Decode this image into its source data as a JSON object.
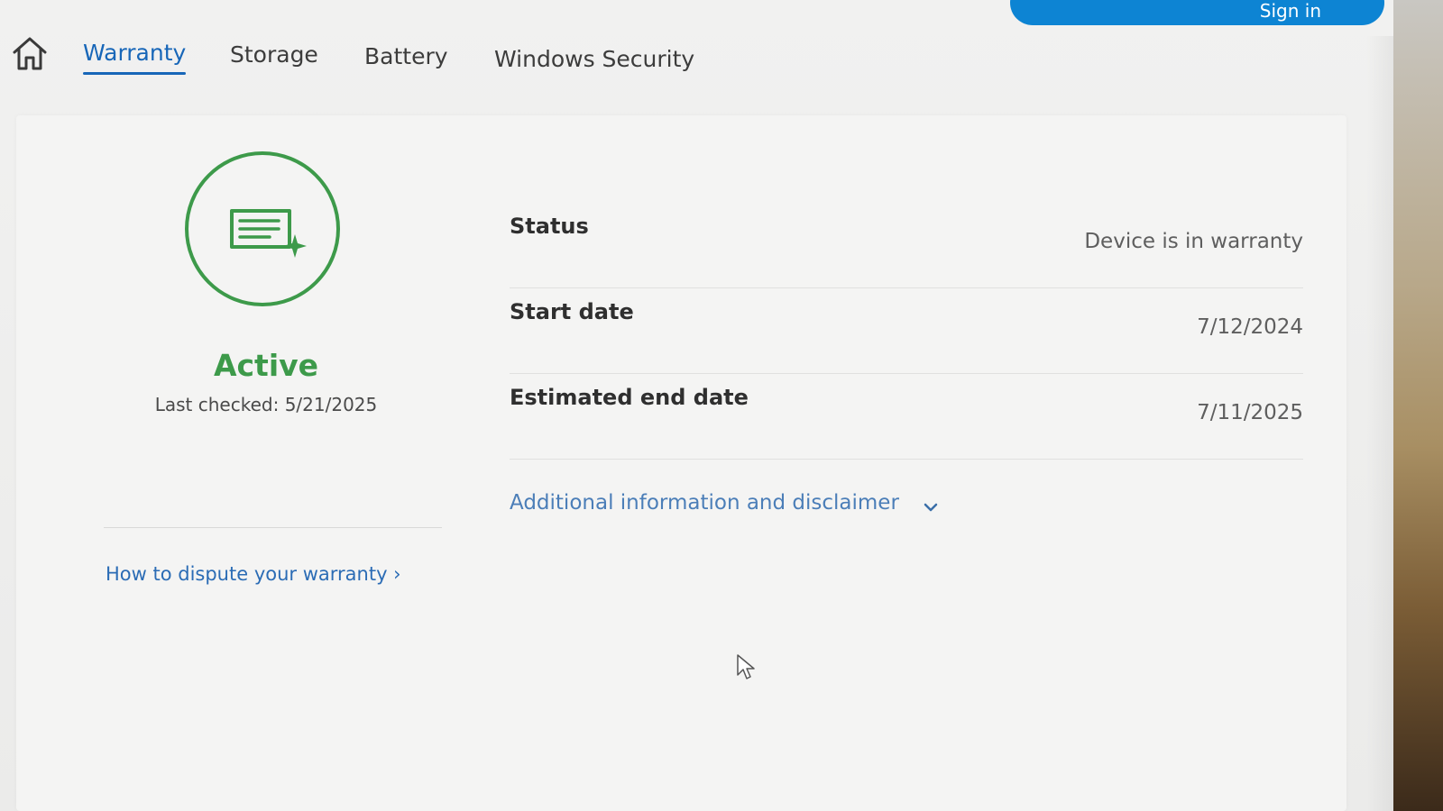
{
  "header": {
    "signin_label": "Sign in"
  },
  "nav": {
    "home_icon": "home-icon",
    "tabs": [
      {
        "label": "Warranty",
        "active": true
      },
      {
        "label": "Storage",
        "active": false
      },
      {
        "label": "Battery",
        "active": false
      },
      {
        "label": "Windows Security",
        "active": false
      }
    ]
  },
  "warranty": {
    "badge_icon": "document-star-icon",
    "status_label": "Active",
    "last_checked": "Last checked: 5/21/2025",
    "details": [
      {
        "label": "Status",
        "value": "Device is in warranty"
      },
      {
        "label": "Start date",
        "value": "7/12/2024"
      },
      {
        "label": "Estimated end date",
        "value": "7/11/2025"
      }
    ],
    "disclaimer_label": "Additional information and disclaimer",
    "dispute_link": "How to dispute your warranty ›"
  },
  "colors": {
    "accent_blue": "#1766b8",
    "status_green": "#3d9a4a",
    "button_blue": "#0d84d3"
  }
}
